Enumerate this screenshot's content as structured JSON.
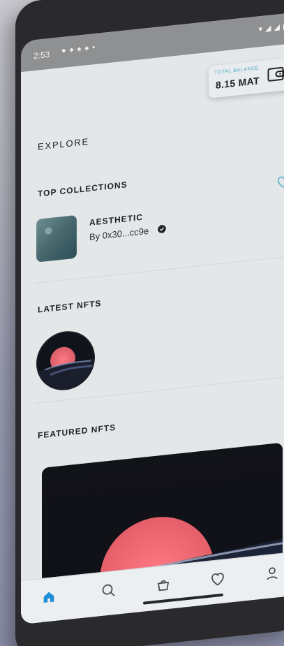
{
  "status_bar": {
    "time": "2:53",
    "notification_icons": [
      "chat-icon",
      "snapchat-icon",
      "snapchat-icon",
      "snapchat-icon",
      "dot-icon"
    ],
    "signal_icons": [
      "wifi-icon",
      "signal-icon",
      "signal-icon",
      "battery-icon"
    ]
  },
  "balance": {
    "label": "TOTAL BALANCE",
    "value": "8.15 MAT",
    "icon": "wallet-icon"
  },
  "page": {
    "title": "EXPLORE"
  },
  "top_collections": {
    "title": "TOP COLLECTIONS",
    "items": [
      {
        "name": "AESTHETIC",
        "owner": "By 0x30...cc9e",
        "verified_icon": "verified-icon",
        "favorite_icon": "heart-icon"
      }
    ]
  },
  "latest_nfts": {
    "title": "LATEST NFTS"
  },
  "featured_nfts": {
    "title": "FEATURED NFTS"
  },
  "bottom_nav": {
    "items": [
      "home-icon",
      "search-icon",
      "bag-icon",
      "heart-icon",
      "profile-icon"
    ]
  },
  "colors": {
    "accent": "#4fa8c9",
    "nav_active": "#1e8fd6",
    "sun": "#f06a70",
    "background": "#e3e7e8"
  }
}
